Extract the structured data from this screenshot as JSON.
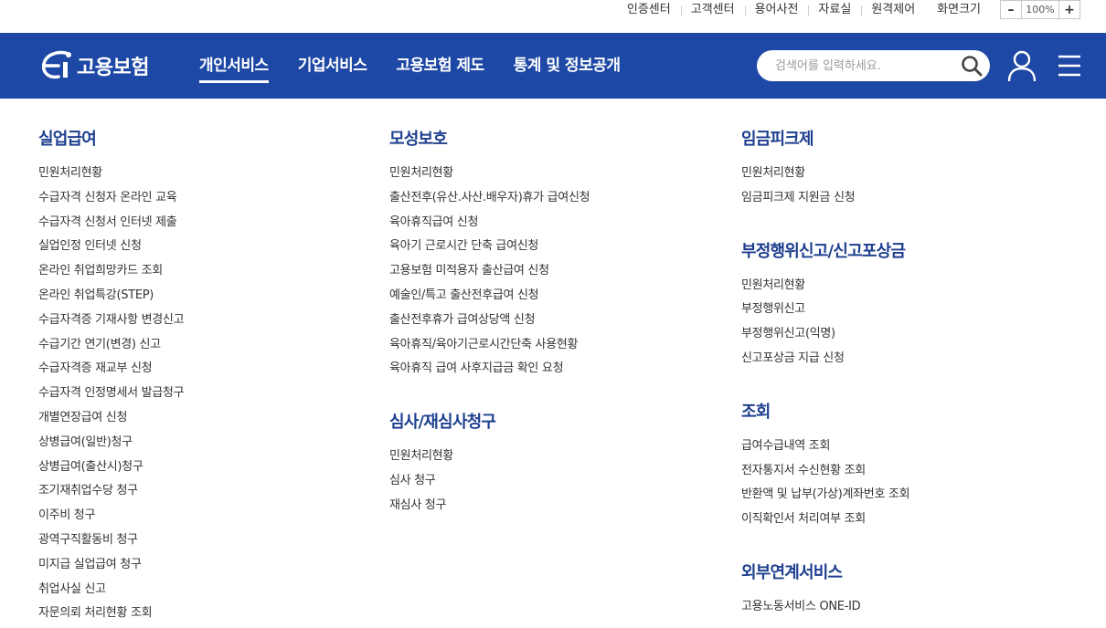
{
  "util": {
    "links": [
      "인증센터",
      "고객센터",
      "용어사전",
      "자료실",
      "원격제어"
    ],
    "zoom_label": "화면크기",
    "zoom_minus": "–",
    "zoom_value": "100%",
    "zoom_plus": "+"
  },
  "header": {
    "logo_text": "고용보험",
    "nav": [
      "개인서비스",
      "기업서비스",
      "고용보험 제도",
      "통계 및 정보공개"
    ],
    "active_nav": "개인서비스",
    "search_placeholder": "검색어를 입력하세요.",
    "brand_color": "#1e48a5",
    "title_color": "#1e3f8f"
  },
  "menu": {
    "col1": [
      {
        "title": "실업급여",
        "items": [
          "민원처리현황",
          "수급자격 신청자 온라인 교육",
          "수급자격 신청서 인터넷 제출",
          "실업인정 인터넷 신청",
          "온라인 취업희망카드 조회",
          "온라인 취업특강(STEP)",
          "수급자격증 기재사항 변경신고",
          "수급기간 연기(변경) 신고",
          "수급자격증 재교부 신청",
          "수급자격 인정명세서 발급청구",
          "개별연장급여 신청",
          "상병급여(일반)청구",
          "상병급여(출산시)청구",
          "조기재취업수당 청구",
          "이주비 청구",
          "광역구직활동비 청구",
          "미지급 실업급여 청구",
          "취업사실 신고",
          "자문의뢰 처리현황 조회"
        ]
      }
    ],
    "col2": [
      {
        "title": "모성보호",
        "items": [
          "민원처리현황",
          "출산전후(유산.사산.배우자)휴가 급여신청",
          "육아휴직급여 신청",
          "육아기 근로시간 단축 급여신청",
          "고용보험 미적용자 출산급여 신청",
          "예술인/특고 출산전후급여 신청",
          "출산전후휴가 급여상당액 신청",
          "육아휴직/육아기근로시간단축 사용현황",
          "육아휴직 급여 사후지급금 확인 요청"
        ]
      },
      {
        "title": "심사/재심사청구",
        "items": [
          "민원처리현황",
          "심사 청구",
          "재심사 청구"
        ]
      }
    ],
    "col3": [
      {
        "title": "임금피크제",
        "items": [
          "민원처리현황",
          "임금피크제 지원금 신청"
        ]
      },
      {
        "title": "부정행위신고/신고포상금",
        "items": [
          "민원처리현황",
          "부정행위신고",
          "부정행위신고(익명)",
          "신고포상금 지급 신청"
        ]
      },
      {
        "title": "조회",
        "items": [
          "급여수급내역 조회",
          "전자통지서 수신현황 조회",
          "반환액 및 납부(가상)계좌번호 조회",
          "이직확인서 처리여부 조회"
        ]
      },
      {
        "title": "외부연계서비스",
        "items": [
          "고용노동서비스 ONE-ID"
        ]
      }
    ]
  }
}
